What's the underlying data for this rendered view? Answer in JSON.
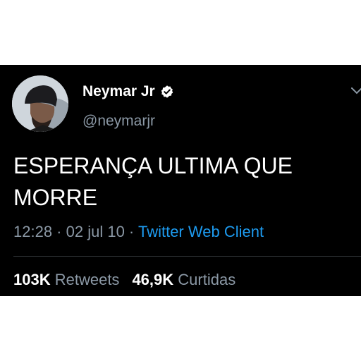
{
  "user": {
    "display_name": "Neymar Jr",
    "handle": "@neymarjr",
    "verified": true
  },
  "tweet": {
    "text_line1": "ESPERANÇA ULTIMA QUE",
    "text_line2": "MORRE"
  },
  "meta": {
    "time": "12:28",
    "sep1": " · ",
    "date": "02 jul 10",
    "sep2": " · ",
    "source": "Twitter Web Client"
  },
  "stats": {
    "retweets_count": "103K",
    "retweets_label": "Retweets",
    "likes_count": "46,9K",
    "likes_label": "Curtidas"
  },
  "colors": {
    "background": "#000000",
    "text_primary": "#ffffff",
    "text_secondary": "#8b98a5",
    "link": "#1d9bf0",
    "verified_badge": "#ffffff"
  },
  "icons": [
    "verified-icon",
    "chevron-down-icon"
  ]
}
